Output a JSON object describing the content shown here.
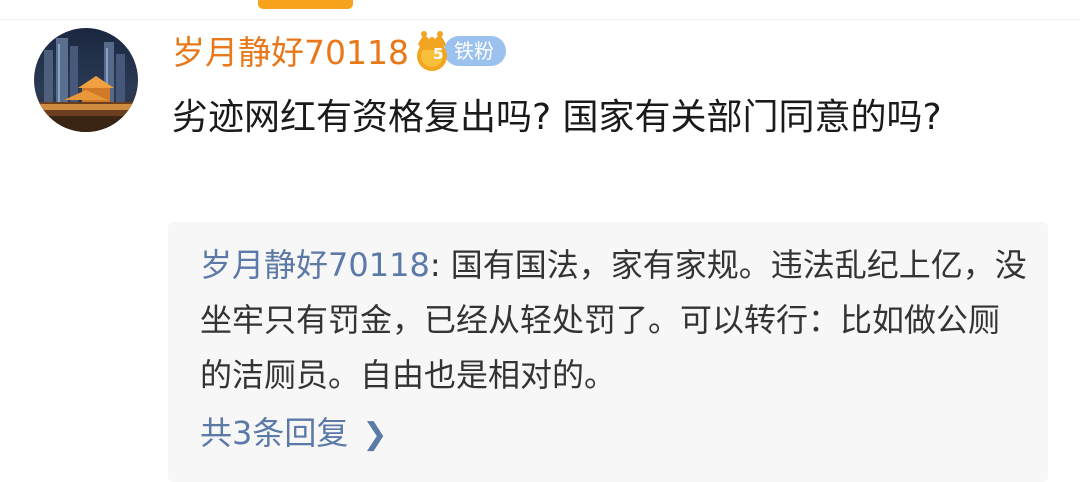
{
  "comment": {
    "username": "岁月静好70118",
    "badge": {
      "label": "铁粉",
      "level": "5",
      "icon": "crown-icon",
      "color": "#9bc2ee"
    },
    "avatar": "avatar-city-night-image",
    "text": "劣迹网红有资格复出吗? 国家有关部门同意的吗?"
  },
  "reply": {
    "author": "岁月静好70118",
    "separator": ": ",
    "text": "国有国法，家有家规。违法乱纪上亿，没坐牢只有罚金，已经从轻处罚了。可以转行：比如做公厕的洁厕员。自由也是相对的。",
    "view_more_label": "共3条回复",
    "chevron_icon": "chevron-right-icon"
  },
  "colors": {
    "accent": "#f7a21b",
    "username": "#e8781a",
    "link": "#5c7aa7"
  }
}
